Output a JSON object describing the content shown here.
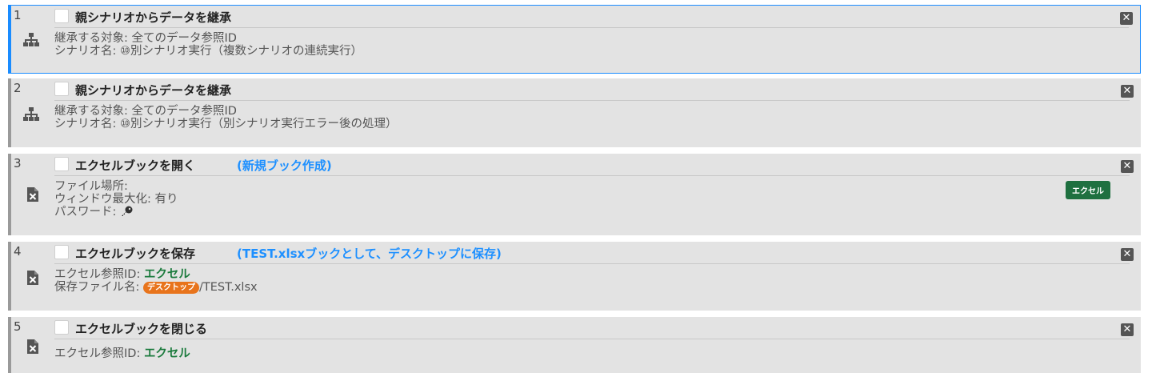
{
  "steps": [
    {
      "num": "1",
      "title": "親シナリオからデータを継承",
      "line1": "継承する対象: 全てのデータ参照ID",
      "line2": "シナリオ名: ⑩別シナリオ実行（複数シナリオの連続実行）",
      "icon": "sitemap-icon"
    },
    {
      "num": "2",
      "title": "親シナリオからデータを継承",
      "line1": "継承する対象: 全てのデータ参照ID",
      "line2": "シナリオ名: ⑩別シナリオ実行（別シナリオ実行エラー後の処理）",
      "icon": "sitemap-icon"
    },
    {
      "num": "3",
      "title": "エクセルブックを開く",
      "note": "(新規ブック作成)",
      "line1": "ファイル場所:",
      "line2": "ウィンドウ最大化: 有り",
      "line3_label": "パスワード:",
      "tag": "エクセル",
      "icon": "excel-file-icon"
    },
    {
      "num": "4",
      "title": "エクセルブックを保存",
      "note": "(TEST.xlsxブックとして、デスクトップに保存)",
      "line1_label": "エクセル参照ID:",
      "line1_value": "エクセル",
      "line2_label": "保存ファイル名:",
      "line2_badge": "デスクトップ",
      "line2_value": "/TEST.xlsx",
      "icon": "excel-file-icon"
    },
    {
      "num": "5",
      "title": "エクセルブックを閉じる",
      "line1_label": "エクセル参照ID:",
      "line1_value": "エクセル",
      "icon": "excel-file-icon"
    }
  ],
  "close_glyph": "✕",
  "colors": {
    "selected_border": "#1a8cff",
    "note": "#1e90ff",
    "excel_green": "#1f7040",
    "desktop_orange": "#e8741c"
  }
}
